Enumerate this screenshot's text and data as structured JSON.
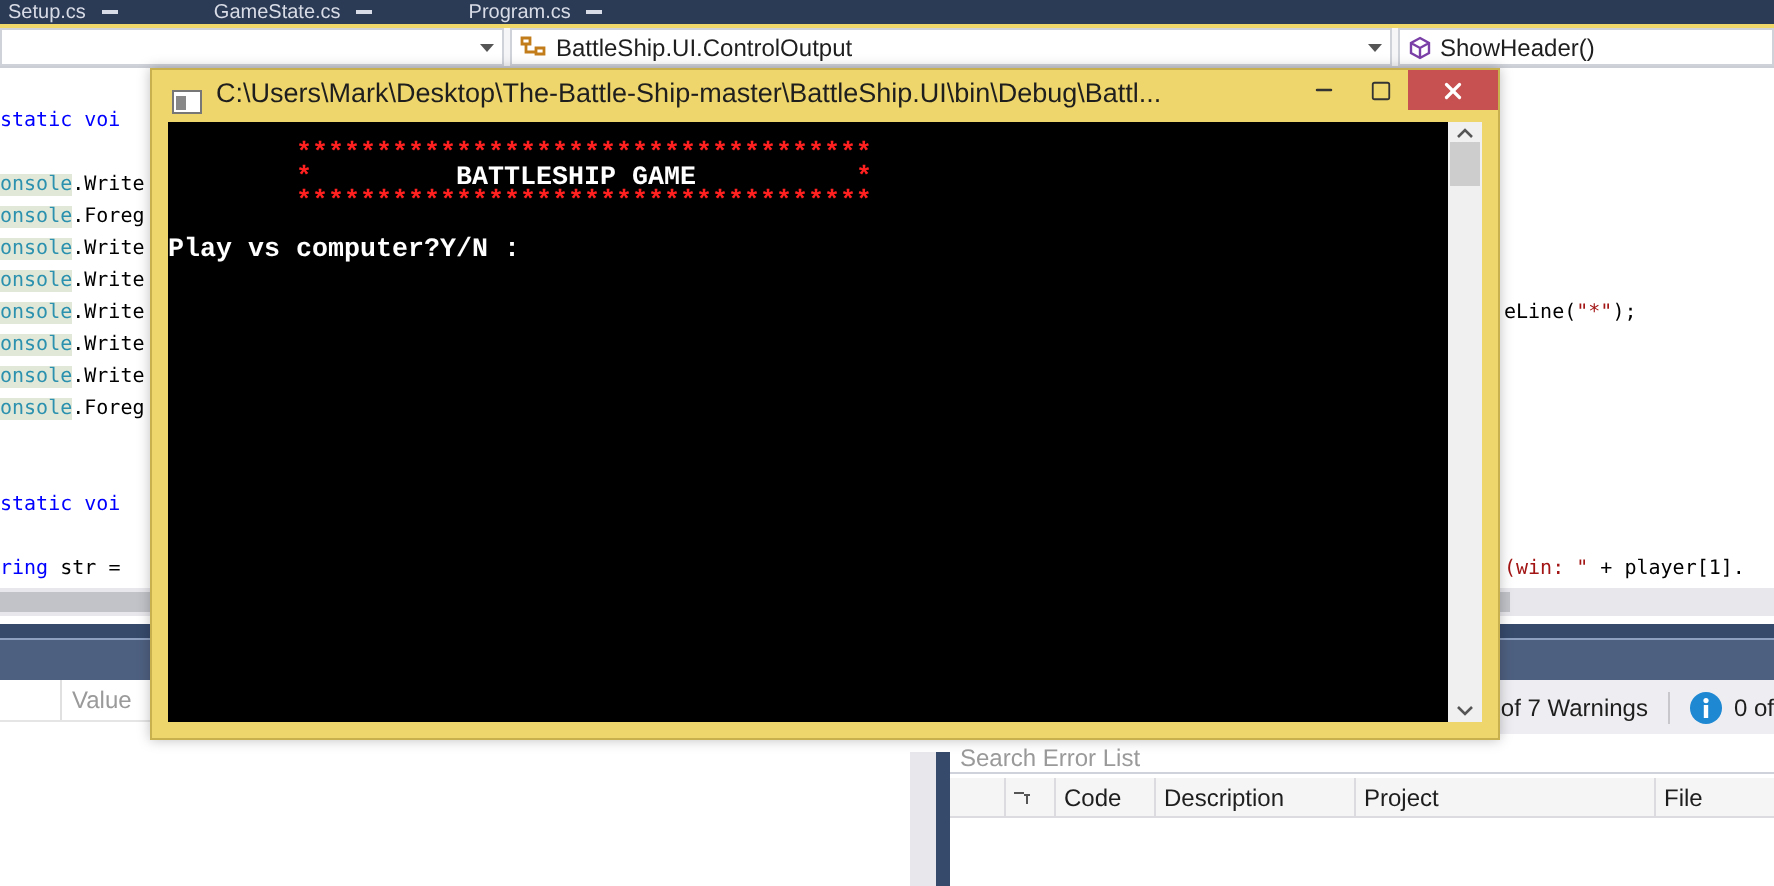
{
  "editor_tabs": [
    {
      "label": "Setup.cs"
    },
    {
      "label": "GameState.cs"
    },
    {
      "label": "Program.cs"
    }
  ],
  "nav_bar": {
    "type_dropdown": "BattleShip.UI.ControlOutput",
    "member_dropdown": "ShowHeader()"
  },
  "code_lines": [
    {
      "highlighted": false
    },
    {
      "highlighted": false,
      "left": [
        {
          "kind": "keyword",
          "text": "static voi"
        }
      ]
    },
    {
      "highlighted": false
    },
    {
      "highlighted": true,
      "left": [
        {
          "kind": "type",
          "text": "onsole"
        },
        {
          "kind": "plain",
          "text": ".Write"
        }
      ]
    },
    {
      "highlighted": true,
      "left": [
        {
          "kind": "type",
          "text": "onsole"
        },
        {
          "kind": "plain",
          "text": ".Foreg"
        }
      ]
    },
    {
      "highlighted": true,
      "left": [
        {
          "kind": "type",
          "text": "onsole"
        },
        {
          "kind": "plain",
          "text": ".Write"
        }
      ]
    },
    {
      "highlighted": true,
      "left": [
        {
          "kind": "type",
          "text": "onsole"
        },
        {
          "kind": "plain",
          "text": ".Write"
        }
      ]
    },
    {
      "highlighted": true,
      "left": [
        {
          "kind": "type",
          "text": "onsole"
        },
        {
          "kind": "plain",
          "text": ".Write"
        }
      ],
      "right": [
        {
          "kind": "plain",
          "text": "eLine("
        },
        {
          "kind": "string",
          "text": "\"*\""
        },
        {
          "kind": "plain",
          "text": ");"
        }
      ]
    },
    {
      "highlighted": true,
      "left": [
        {
          "kind": "type",
          "text": "onsole"
        },
        {
          "kind": "plain",
          "text": ".Write"
        }
      ]
    },
    {
      "highlighted": true,
      "left": [
        {
          "kind": "type",
          "text": "onsole"
        },
        {
          "kind": "plain",
          "text": ".Write"
        }
      ]
    },
    {
      "highlighted": true,
      "left": [
        {
          "kind": "type",
          "text": "onsole"
        },
        {
          "kind": "plain",
          "text": ".Foreg"
        }
      ]
    },
    {
      "highlighted": false
    },
    {
      "highlighted": false
    },
    {
      "highlighted": false,
      "left": [
        {
          "kind": "keyword",
          "text": "static voi"
        }
      ]
    },
    {
      "highlighted": false
    },
    {
      "highlighted": false,
      "left": [
        {
          "kind": "keyword",
          "text": "ring"
        },
        {
          "kind": "plain",
          "text": " str ="
        }
      ],
      "right": [
        {
          "kind": "string",
          "text": "(win: \""
        },
        {
          "kind": "plain",
          "text": " + player[1]."
        }
      ]
    }
  ],
  "watch_panel": {
    "columns": [
      "Value"
    ]
  },
  "error_list": {
    "warnings": "of 7 Warnings",
    "messages": "0 of",
    "search": {
      "placeholder": "Search Error List"
    },
    "columns": [
      "Code",
      "Description",
      "Project",
      "File"
    ]
  },
  "console_window": {
    "title": "C:\\Users\\Mark\\Desktop\\The-Battle-Ship-master\\BattleShip.UI\\bin\\Debug\\Battl...",
    "banner": {
      "top": "************************************",
      "left": "*",
      "title": "BATTLESHIP GAME",
      "right": "*",
      "bottom": "************************************"
    },
    "prompt": "Play vs computer?Y/N :"
  }
}
